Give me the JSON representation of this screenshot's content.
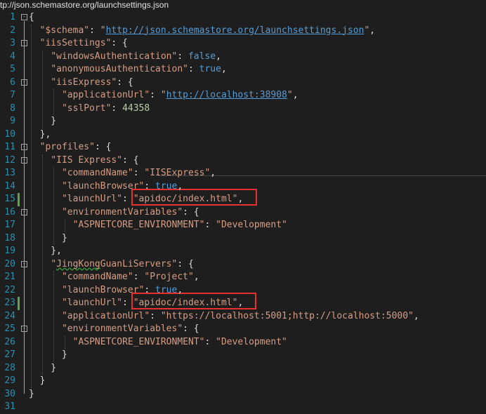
{
  "window": {
    "title": "tp://json.schemastore.org/launchsettings.json"
  },
  "lines": [
    {
      "n": "1",
      "fold": "-",
      "mod": false,
      "html_parts": [
        {
          "t": "p",
          "v": "{"
        }
      ]
    },
    {
      "n": "2",
      "mod": false,
      "html_parts": [
        {
          "t": "p",
          "v": "  "
        },
        {
          "t": "k",
          "v": "\"$schema\""
        },
        {
          "t": "p",
          "v": ": "
        },
        {
          "t": "s",
          "v": "\""
        },
        {
          "t": "u",
          "v": "http://json.schemastore.org/launchsettings.json"
        },
        {
          "t": "s",
          "v": "\""
        },
        {
          "t": "p",
          "v": ","
        }
      ]
    },
    {
      "n": "3",
      "fold": "-",
      "mod": false,
      "html_parts": [
        {
          "t": "p",
          "v": "  "
        },
        {
          "t": "k",
          "v": "\"iisSettings\""
        },
        {
          "t": "p",
          "v": ": {"
        }
      ]
    },
    {
      "n": "4",
      "mod": false,
      "html_parts": [
        {
          "t": "p",
          "v": "    "
        },
        {
          "t": "k",
          "v": "\"windowsAuthentication\""
        },
        {
          "t": "p",
          "v": ": "
        },
        {
          "t": "b",
          "v": "false"
        },
        {
          "t": "p",
          "v": ","
        }
      ]
    },
    {
      "n": "5",
      "mod": false,
      "html_parts": [
        {
          "t": "p",
          "v": "    "
        },
        {
          "t": "k",
          "v": "\"anonymousAuthentication\""
        },
        {
          "t": "p",
          "v": ": "
        },
        {
          "t": "b",
          "v": "true"
        },
        {
          "t": "p",
          "v": ","
        }
      ]
    },
    {
      "n": "6",
      "fold": "-",
      "mod": false,
      "html_parts": [
        {
          "t": "p",
          "v": "    "
        },
        {
          "t": "k",
          "v": "\"iisExpress\""
        },
        {
          "t": "p",
          "v": ": {"
        }
      ]
    },
    {
      "n": "7",
      "mod": false,
      "html_parts": [
        {
          "t": "p",
          "v": "      "
        },
        {
          "t": "k",
          "v": "\"applicationUrl\""
        },
        {
          "t": "p",
          "v": ": "
        },
        {
          "t": "s",
          "v": "\""
        },
        {
          "t": "u",
          "v": "http://localhost:38908"
        },
        {
          "t": "s",
          "v": "\""
        },
        {
          "t": "p",
          "v": ","
        }
      ]
    },
    {
      "n": "8",
      "mod": false,
      "html_parts": [
        {
          "t": "p",
          "v": "      "
        },
        {
          "t": "k",
          "v": "\"sslPort\""
        },
        {
          "t": "p",
          "v": ": "
        },
        {
          "t": "n",
          "v": "44358"
        }
      ]
    },
    {
      "n": "9",
      "mod": false,
      "html_parts": [
        {
          "t": "p",
          "v": "    }"
        }
      ]
    },
    {
      "n": "10",
      "mod": false,
      "html_parts": [
        {
          "t": "p",
          "v": "  },"
        }
      ]
    },
    {
      "n": "11",
      "fold": "-",
      "mod": false,
      "html_parts": [
        {
          "t": "p",
          "v": "  "
        },
        {
          "t": "k",
          "v": "\"profiles\""
        },
        {
          "t": "p",
          "v": ": {"
        }
      ]
    },
    {
      "n": "12",
      "fold": "-",
      "mod": false,
      "html_parts": [
        {
          "t": "p",
          "v": "    "
        },
        {
          "t": "k",
          "v": "\"IIS Express\""
        },
        {
          "t": "p",
          "v": ": {"
        }
      ]
    },
    {
      "n": "13",
      "mod": false,
      "html_parts": [
        {
          "t": "p",
          "v": "      "
        },
        {
          "t": "k",
          "v": "\"commandName\""
        },
        {
          "t": "p",
          "v": ": "
        },
        {
          "t": "s",
          "v": "\"IISExpress\""
        },
        {
          "t": "p",
          "v": ","
        }
      ]
    },
    {
      "n": "14",
      "mod": false,
      "html_parts": [
        {
          "t": "p",
          "v": "      "
        },
        {
          "t": "k",
          "v": "\"launchBrowser\""
        },
        {
          "t": "p",
          "v": ": "
        },
        {
          "t": "b",
          "v": "true"
        },
        {
          "t": "p",
          "v": ","
        }
      ]
    },
    {
      "n": "15",
      "mod": true,
      "html_parts": [
        {
          "t": "p",
          "v": "      "
        },
        {
          "t": "k",
          "v": "\"launchUrl\""
        },
        {
          "t": "p",
          "v": ": "
        },
        {
          "t": "s",
          "v": "\"apidoc/index.html\""
        },
        {
          "t": "p",
          "v": ","
        }
      ]
    },
    {
      "n": "16",
      "fold": "-",
      "mod": false,
      "html_parts": [
        {
          "t": "p",
          "v": "      "
        },
        {
          "t": "k",
          "v": "\"environmentVariables\""
        },
        {
          "t": "p",
          "v": ": {"
        }
      ]
    },
    {
      "n": "17",
      "mod": false,
      "html_parts": [
        {
          "t": "p",
          "v": "        "
        },
        {
          "t": "k",
          "v": "\"ASPNETCORE_ENVIRONMENT\""
        },
        {
          "t": "p",
          "v": ": "
        },
        {
          "t": "s",
          "v": "\"Development\""
        }
      ]
    },
    {
      "n": "18",
      "mod": false,
      "html_parts": [
        {
          "t": "p",
          "v": "      }"
        }
      ]
    },
    {
      "n": "19",
      "mod": false,
      "html_parts": [
        {
          "t": "p",
          "v": "    },"
        }
      ]
    },
    {
      "n": "20",
      "fold": "-",
      "mod": false,
      "html_parts": [
        {
          "t": "p",
          "v": "    "
        },
        {
          "t": "k",
          "v": "\""
        },
        {
          "t": "ksq",
          "v": "JingKong"
        },
        {
          "t": "k",
          "v": "GuanLiServers\""
        },
        {
          "t": "p",
          "v": ": {"
        }
      ]
    },
    {
      "n": "21",
      "mod": false,
      "html_parts": [
        {
          "t": "p",
          "v": "      "
        },
        {
          "t": "k",
          "v": "\"commandName\""
        },
        {
          "t": "p",
          "v": ": "
        },
        {
          "t": "s",
          "v": "\"Project\""
        },
        {
          "t": "p",
          "v": ","
        }
      ]
    },
    {
      "n": "22",
      "mod": false,
      "html_parts": [
        {
          "t": "p",
          "v": "      "
        },
        {
          "t": "k",
          "v": "\"launchBrowser\""
        },
        {
          "t": "p",
          "v": ": "
        },
        {
          "t": "b",
          "v": "true"
        },
        {
          "t": "p",
          "v": ","
        }
      ]
    },
    {
      "n": "23",
      "mod": true,
      "html_parts": [
        {
          "t": "p",
          "v": "      "
        },
        {
          "t": "k",
          "v": "\"launchUrl\""
        },
        {
          "t": "p",
          "v": ": "
        },
        {
          "t": "s",
          "v": "\"apidoc/index.html\""
        },
        {
          "t": "p",
          "v": ","
        }
      ]
    },
    {
      "n": "24",
      "mod": false,
      "html_parts": [
        {
          "t": "p",
          "v": "      "
        },
        {
          "t": "k",
          "v": "\"applicationUrl\""
        },
        {
          "t": "p",
          "v": ": "
        },
        {
          "t": "s",
          "v": "\"https://localhost:5001;http://localhost:5000\""
        },
        {
          "t": "p",
          "v": ","
        }
      ]
    },
    {
      "n": "25",
      "fold": "-",
      "mod": false,
      "html_parts": [
        {
          "t": "p",
          "v": "      "
        },
        {
          "t": "k",
          "v": "\"environmentVariables\""
        },
        {
          "t": "p",
          "v": ": {"
        }
      ]
    },
    {
      "n": "26",
      "mod": false,
      "html_parts": [
        {
          "t": "p",
          "v": "        "
        },
        {
          "t": "k",
          "v": "\"ASPNETCORE_ENVIRONMENT\""
        },
        {
          "t": "p",
          "v": ": "
        },
        {
          "t": "s",
          "v": "\"Development\""
        }
      ]
    },
    {
      "n": "27",
      "mod": false,
      "html_parts": [
        {
          "t": "p",
          "v": "      }"
        }
      ]
    },
    {
      "n": "28",
      "mod": false,
      "html_parts": [
        {
          "t": "p",
          "v": "    }"
        }
      ]
    },
    {
      "n": "29",
      "mod": false,
      "html_parts": [
        {
          "t": "p",
          "v": "  }"
        }
      ]
    },
    {
      "n": "30",
      "mod": false,
      "html_parts": [
        {
          "t": "p",
          "v": "}"
        }
      ]
    },
    {
      "n": "31",
      "mod": false,
      "html_parts": []
    }
  ],
  "colors": {
    "background": "#1e1e1e",
    "line_number": "#2b91af",
    "property": "#d69d85",
    "keyword": "#569cd6",
    "number": "#b5cea8",
    "highlight_box": "#e8302e",
    "modified_marker": "#57a64a"
  }
}
